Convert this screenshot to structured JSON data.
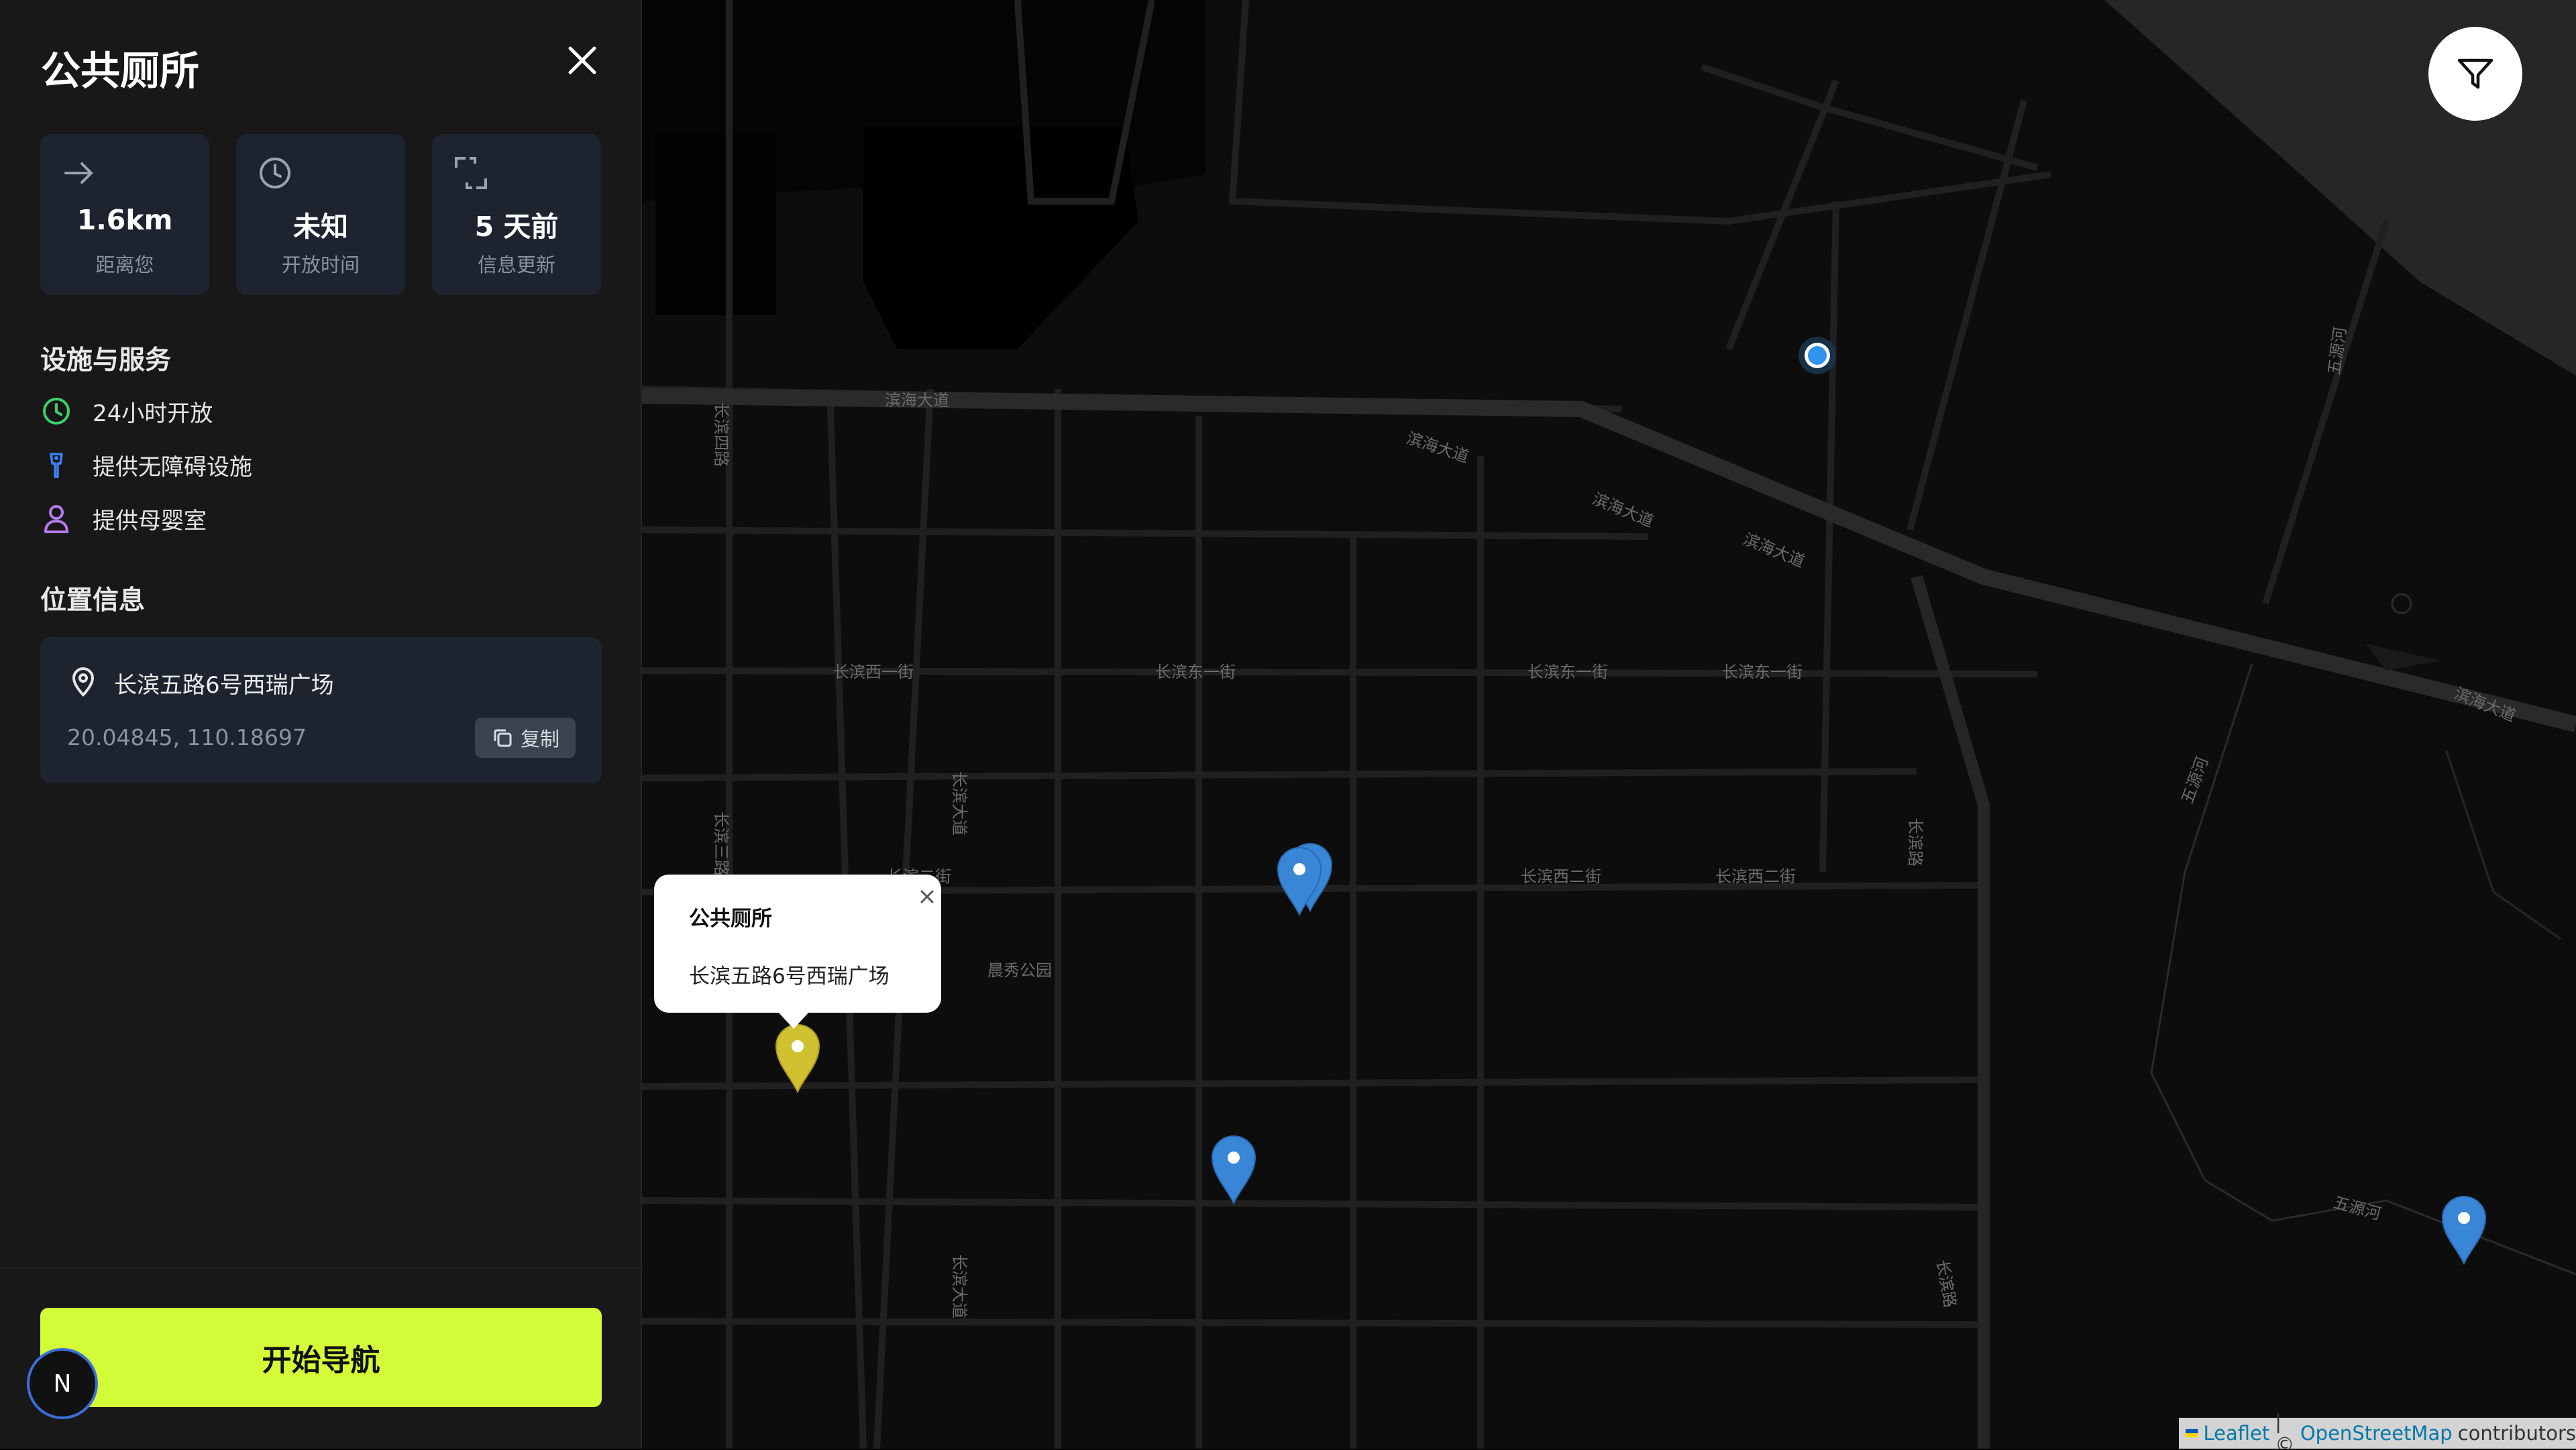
{
  "sidebar": {
    "title": "公共厕所",
    "stats": [
      {
        "icon": "arrow-right-icon",
        "value": "1.6km",
        "label": "距离您"
      },
      {
        "icon": "clock-icon",
        "value": "未知",
        "label": "开放时间"
      },
      {
        "icon": "refresh-icon",
        "value": "5 天前",
        "label": "信息更新"
      }
    ],
    "facilities_heading": "设施与服务",
    "facilities": [
      {
        "icon": "clock-icon",
        "label": "24小时开放",
        "color": "#3ecf6a"
      },
      {
        "icon": "accessibility-icon",
        "label": "提供无障碍设施",
        "color": "#3b82f6"
      },
      {
        "icon": "person-icon",
        "label": "提供母婴室",
        "color": "#b57cf0"
      }
    ],
    "location_heading": "位置信息",
    "location": {
      "address": "长滨五路6号西瑞广场",
      "coords": "20.04845, 110.18697",
      "copy_label": "复制"
    },
    "nav_button": "开始导航",
    "avatar_letter": "N"
  },
  "map": {
    "popup": {
      "title": "公共厕所",
      "address": "长滨五路6号西瑞广场"
    },
    "road_labels": [
      "滨海大道",
      "滨海大道",
      "滨海大道",
      "滨海大道",
      "滨海大道",
      "长滨西一街",
      "长滨东一街",
      "长滨东一街",
      "长滨东一街",
      "长滨西二街",
      "长滨西二街",
      "长滨二街",
      "长滨四路",
      "长滨三路",
      "长滨大道",
      "长滨大道",
      "长滨路",
      "长滨路",
      "五源河",
      "五源河",
      "五源河",
      "晨秀公园"
    ],
    "attribution": {
      "leaflet": "Leaflet",
      "separator": "| ©",
      "osm": "OpenStreetMap",
      "suffix": "contributors"
    },
    "colors": {
      "selected_marker": "#cfc130",
      "marker": "#3a86d6",
      "user_location": "#2f95f0",
      "accent": "#d4fb37"
    }
  }
}
